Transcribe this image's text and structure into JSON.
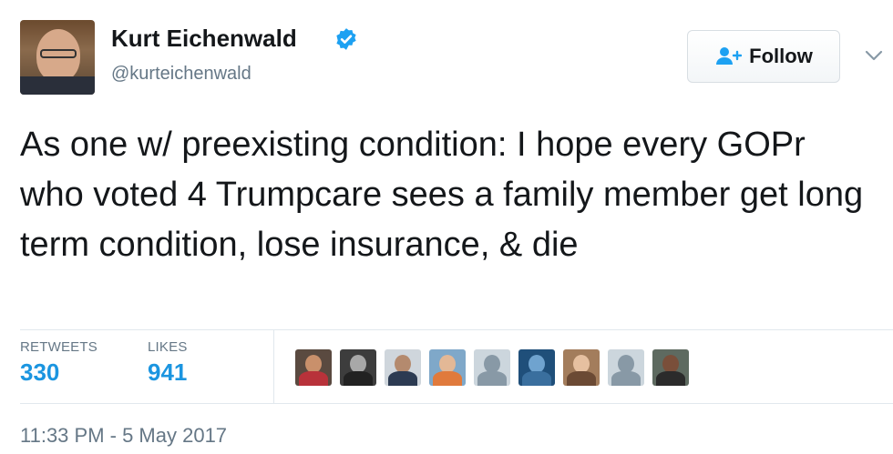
{
  "author": {
    "name": "Kurt Eichenwald",
    "handle": "@kurteichenwald",
    "verified": true
  },
  "follow_button": {
    "label": "Follow",
    "icon": "add-user-icon"
  },
  "tweet": {
    "text": "As one w/ preexisting condition: I hope every GOPr who voted 4 Trumpcare sees a family member get long term condition, lose insurance, & die"
  },
  "stats": {
    "retweets": {
      "label": "RETWEETS",
      "count": "330"
    },
    "likes": {
      "label": "LIKES",
      "count": "941"
    }
  },
  "timestamp": "11:33 PM - 5 May 2017",
  "colors": {
    "accent": "#1b95e0",
    "verified": "#1da1f2",
    "muted": "#657786",
    "text": "#14171a"
  }
}
